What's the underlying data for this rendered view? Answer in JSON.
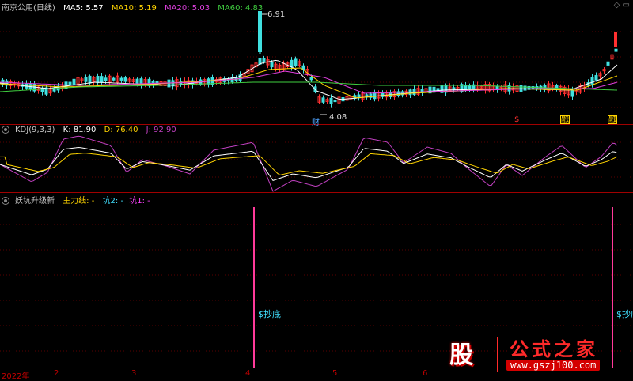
{
  "main": {
    "stock_title": "南京公用(日线)",
    "ma": [
      {
        "label": "MA5: 5.57",
        "color": "#ffffff"
      },
      {
        "label": "MA10: 5.19",
        "color": "#ffd400"
      },
      {
        "label": "MA20: 5.03",
        "color": "#e040e0"
      },
      {
        "label": "MA60: 4.83",
        "color": "#40d040"
      }
    ],
    "high_label": "6.91",
    "low_label": "4.08",
    "marks": [
      {
        "text": "财",
        "color": "#4fa3ff"
      },
      {
        "text": "$",
        "color": "#ff3030"
      },
      {
        "text": "融",
        "color": "#ffd400"
      },
      {
        "text": "融",
        "color": "#ffd400"
      }
    ],
    "window_controls": "◇ ▭"
  },
  "kdj": {
    "title": "KDJ(9,3,3)",
    "k_label": "K: 81.90",
    "d_label": "D: 76.40",
    "j_label": "J: 92.90",
    "colors": {
      "k": "#ffffff",
      "d": "#ffd400",
      "j": "#c040c0"
    }
  },
  "indicator": {
    "title": "妖坑升级新",
    "main_line": "主力线: -",
    "keng2": "坑2: -",
    "keng1": "坑1: -",
    "signal_text": "$抄底",
    "signal_color": "#ff3a9a"
  },
  "xaxis": [
    "2022年",
    "2",
    "3",
    "4",
    "5",
    "6"
  ],
  "watermark": {
    "gu": "股",
    "title": "公式之家",
    "url": "www.gszj100.com"
  }
}
